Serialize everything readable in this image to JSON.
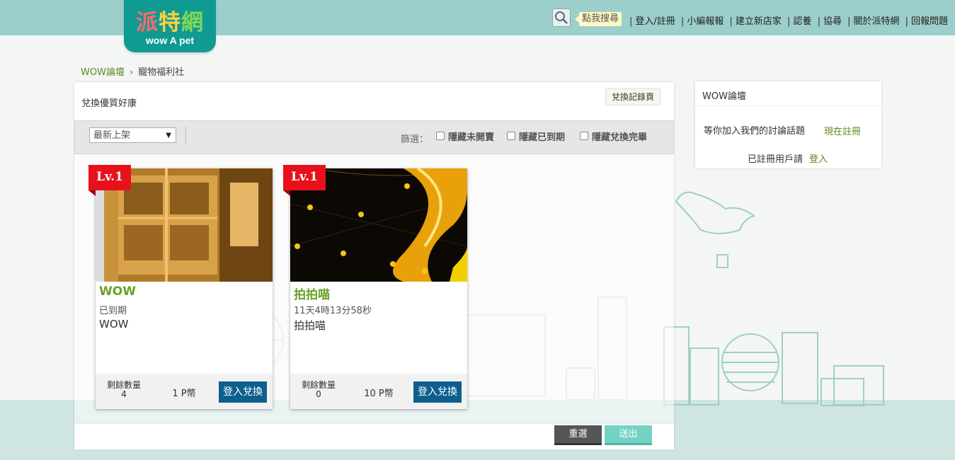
{
  "logo": {
    "zh": [
      "派",
      "特",
      "網"
    ],
    "en": "wow A pet"
  },
  "header": {
    "search_tip": "點我搜尋",
    "nav": [
      "登入/註冊",
      "小編報報",
      "建立新店家",
      "認養",
      "協尋",
      "關於派特網",
      "回報問題"
    ]
  },
  "breadcrumb": {
    "home": "WOW論壇",
    "separator": "›",
    "current": "寵物福利社"
  },
  "panel": {
    "title": "兌換優質好康",
    "record_button": "兌換記錄頁",
    "sort": {
      "selected": "最新上架"
    },
    "filter_label": "篩選：",
    "filters": [
      "隱藏未開賣",
      "隱藏已到期",
      "隱藏兌換完畢"
    ]
  },
  "cards": [
    {
      "level": "Lv.1",
      "name": "WOW",
      "status": "已到期",
      "description": "WOW",
      "quantity_label": "剩餘數量",
      "quantity": "4",
      "points": "1 P幣",
      "button": "登入兌換"
    },
    {
      "level": "Lv.1",
      "name": "拍拍喵",
      "status": "11天4時13分58秒",
      "description": "拍拍喵",
      "quantity_label": "剩餘數量",
      "quantity": "0",
      "points": "10 P幣",
      "button": "登入兌換"
    }
  ],
  "footer_buttons": {
    "reset": "重選",
    "submit": "送出"
  },
  "sidebar": {
    "title": "WOW論壇",
    "invite": "等你加入我們的討論話題",
    "register": "現在註冊",
    "member_prompt": "已註冊用戶請",
    "login": "登入"
  },
  "colors": {
    "topbar": "#9ccfcb",
    "logo_bg": "#0f9a93",
    "accent_green": "#6aa126",
    "ribbon_red": "#e8111b",
    "redeem_button": "#0d5f8e",
    "submit_button": "#72d3c4"
  }
}
